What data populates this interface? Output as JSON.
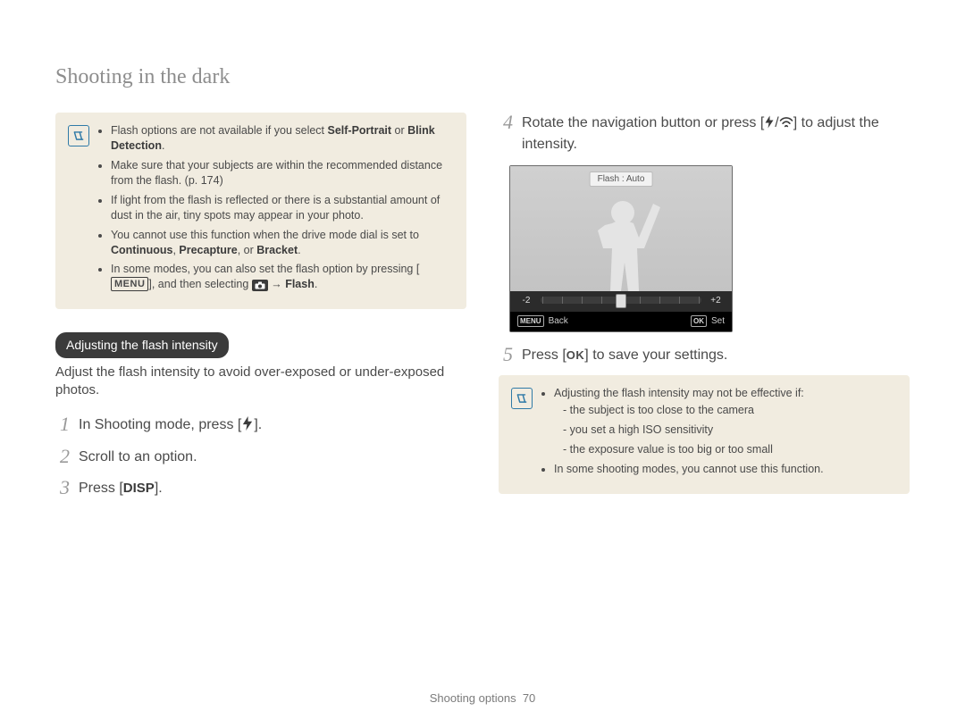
{
  "page_title": "Shooting in the dark",
  "left": {
    "note_bullets": [
      {
        "pre": "Flash options are not available if you select ",
        "b1": "Self-Portrait",
        "mid": " or ",
        "b2": "Blink Detection",
        "post": "."
      },
      {
        "pre": "Make sure that your subjects are within the recommended distance from the flash. (p. 174)",
        "b1": "",
        "mid": "",
        "b2": "",
        "post": ""
      },
      {
        "pre": "If light from the flash is reflected or there is a substantial amount of dust in the air, tiny spots may appear in your photo.",
        "b1": "",
        "mid": "",
        "b2": "",
        "post": ""
      },
      {
        "pre": "You cannot use this function when the drive mode dial is set to ",
        "b1": "Continuous",
        "mid": ", ",
        "b2": "Precapture",
        "post": ""
      },
      {
        "pre": "",
        "b1": "Bracket",
        "mid": "",
        "b2": "",
        "post": ""
      },
      {
        "pre": "In some modes, you can also set the flash option by pressing [",
        "b1": "",
        "mid": "",
        "b2": "",
        "post": "], and then selecting "
      },
      {
        "pre": " → ",
        "b1": "Flash",
        "mid": "",
        "b2": "",
        "post": "."
      }
    ],
    "note4_tail_or": ", or ",
    "menu_badge": "MENU",
    "section_heading": "Adjusting the flash intensity",
    "section_desc": "Adjust the flash intensity to avoid over-exposed or under-exposed photos.",
    "steps": [
      "In Shooting mode, press [",
      "Scroll to an option.",
      "Press ["
    ],
    "step1_tail": "].",
    "step3_label": "DISP",
    "step3_tail": "]."
  },
  "right": {
    "step4_pre": "Rotate the navigation button or press [",
    "step4_mid": "/",
    "step4_post": "] to adjust the intensity.",
    "display": {
      "label": "Flash : Auto",
      "minus": "-2",
      "plus": "+2",
      "back_key": "MENU",
      "back_label": "Back",
      "set_key": "OK",
      "set_label": "Set"
    },
    "step5_pre": "Press [",
    "step5_badge": "OK",
    "step5_post": "] to save your settings.",
    "note2_lead": "Adjusting the flash intensity may not be effective if:",
    "note2_sub": [
      "the subject is too close to the camera",
      "you set a high ISO sensitivity",
      "the exposure value is too big or too small"
    ],
    "note2_li2": "In some shooting modes, you cannot use this function."
  },
  "footer": {
    "label": "Shooting options",
    "page": "70"
  }
}
